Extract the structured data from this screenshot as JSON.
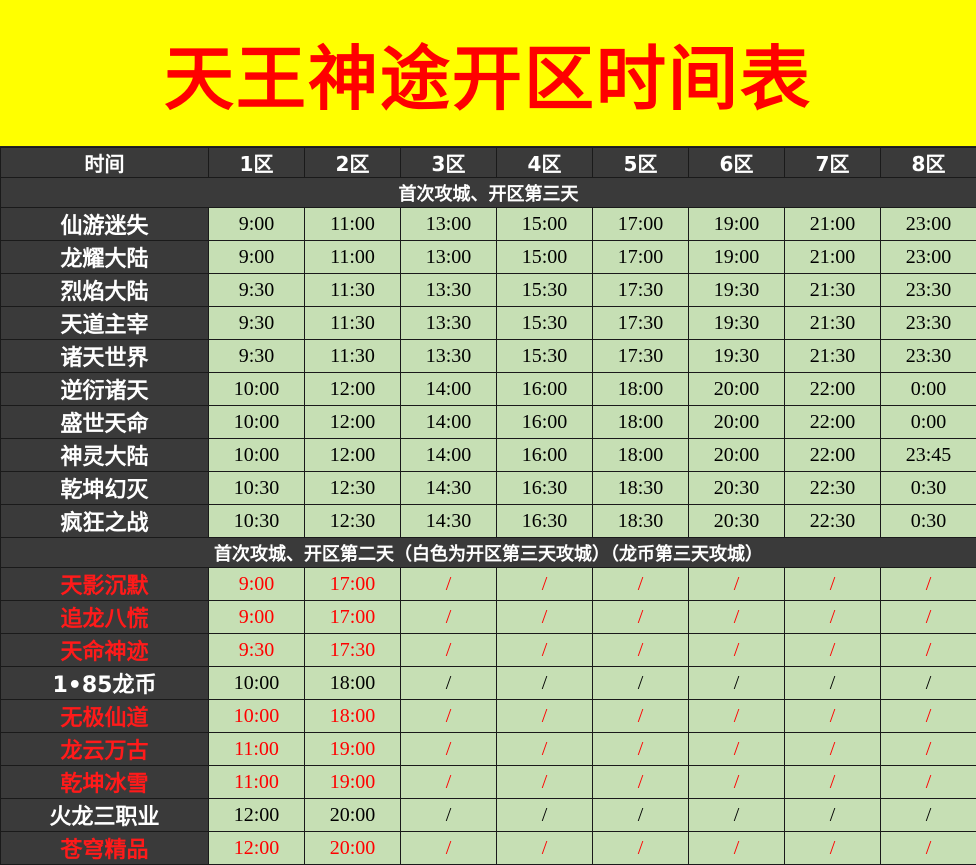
{
  "title": "天王神途开区时间表",
  "colors": {
    "title_bg": "#ffff00",
    "title_text": "#ff0000",
    "header_bg": "#3a3a3a",
    "cell_bg": "#c6dfb4",
    "red_text": "#ff0000"
  },
  "header": [
    "时间",
    "1区",
    "2区",
    "3区",
    "4区",
    "5区",
    "6区",
    "7区",
    "8区"
  ],
  "sections": [
    {
      "label": "首次攻城、开区第三天",
      "rows": [
        {
          "name": "仙游迷失",
          "red": false,
          "times": [
            "9:00",
            "11:00",
            "13:00",
            "15:00",
            "17:00",
            "19:00",
            "21:00",
            "23:00"
          ]
        },
        {
          "name": "龙耀大陆",
          "red": false,
          "times": [
            "9:00",
            "11:00",
            "13:00",
            "15:00",
            "17:00",
            "19:00",
            "21:00",
            "23:00"
          ]
        },
        {
          "name": "烈焰大陆",
          "red": false,
          "times": [
            "9:30",
            "11:30",
            "13:30",
            "15:30",
            "17:30",
            "19:30",
            "21:30",
            "23:30"
          ]
        },
        {
          "name": "天道主宰",
          "red": false,
          "times": [
            "9:30",
            "11:30",
            "13:30",
            "15:30",
            "17:30",
            "19:30",
            "21:30",
            "23:30"
          ]
        },
        {
          "name": "诸天世界",
          "red": false,
          "times": [
            "9:30",
            "11:30",
            "13:30",
            "15:30",
            "17:30",
            "19:30",
            "21:30",
            "23:30"
          ]
        },
        {
          "name": "逆衍诸天",
          "red": false,
          "times": [
            "10:00",
            "12:00",
            "14:00",
            "16:00",
            "18:00",
            "20:00",
            "22:00",
            "0:00"
          ]
        },
        {
          "name": "盛世天命",
          "red": false,
          "times": [
            "10:00",
            "12:00",
            "14:00",
            "16:00",
            "18:00",
            "20:00",
            "22:00",
            "0:00"
          ]
        },
        {
          "name": "神灵大陆",
          "red": false,
          "times": [
            "10:00",
            "12:00",
            "14:00",
            "16:00",
            "18:00",
            "20:00",
            "22:00",
            "23:45"
          ]
        },
        {
          "name": "乾坤幻灭",
          "red": false,
          "times": [
            "10:30",
            "12:30",
            "14:30",
            "16:30",
            "18:30",
            "20:30",
            "22:30",
            "0:30"
          ]
        },
        {
          "name": "疯狂之战",
          "red": false,
          "times": [
            "10:30",
            "12:30",
            "14:30",
            "16:30",
            "18:30",
            "20:30",
            "22:30",
            "0:30"
          ]
        }
      ]
    },
    {
      "label": "首次攻城、开区第二天（白色为开区第三天攻城）（龙币第三天攻城）",
      "rows": [
        {
          "name": "天影沉默",
          "red": true,
          "times": [
            "9:00",
            "17:00",
            "/",
            "/",
            "/",
            "/",
            "/",
            "/"
          ]
        },
        {
          "name": "追龙八慌",
          "red": true,
          "times": [
            "9:00",
            "17:00",
            "/",
            "/",
            "/",
            "/",
            "/",
            "/"
          ]
        },
        {
          "name": "天命神迹",
          "red": true,
          "times": [
            "9:30",
            "17:30",
            "/",
            "/",
            "/",
            "/",
            "/",
            "/"
          ]
        },
        {
          "name": "1•85龙币",
          "red": false,
          "times": [
            "10:00",
            "18:00",
            "/",
            "/",
            "/",
            "/",
            "/",
            "/"
          ]
        },
        {
          "name": "无极仙道",
          "red": true,
          "times": [
            "10:00",
            "18:00",
            "/",
            "/",
            "/",
            "/",
            "/",
            "/"
          ]
        },
        {
          "name": "龙云万古",
          "red": true,
          "times": [
            "11:00",
            "19:00",
            "/",
            "/",
            "/",
            "/",
            "/",
            "/"
          ]
        },
        {
          "name": "乾坤冰雪",
          "red": true,
          "times": [
            "11:00",
            "19:00",
            "/",
            "/",
            "/",
            "/",
            "/",
            "/"
          ]
        },
        {
          "name": "火龙三职业",
          "red": false,
          "times": [
            "12:00",
            "20:00",
            "/",
            "/",
            "/",
            "/",
            "/",
            "/"
          ]
        },
        {
          "name": "苍穹精品",
          "red": true,
          "times": [
            "12:00",
            "20:00",
            "/",
            "/",
            "/",
            "/",
            "/",
            "/"
          ]
        }
      ]
    }
  ]
}
